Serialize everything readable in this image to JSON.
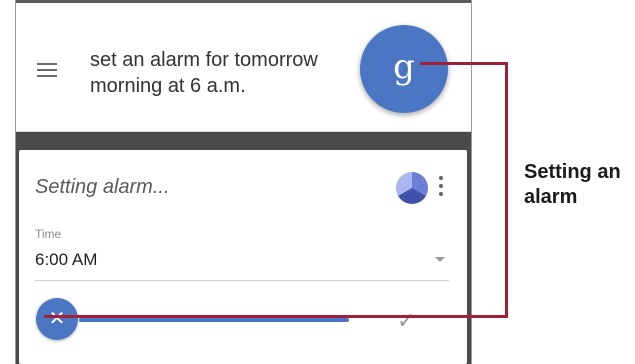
{
  "query": {
    "text": "set an alarm for tomorrow morning at 6 a.m.",
    "mic_glyph": "g"
  },
  "card": {
    "title": "Setting alarm...",
    "time_label": "Time",
    "time_value": "6:00 AM",
    "cancel_glyph": "✕",
    "confirm_glyph": "✓",
    "progress": 0.85
  },
  "callout": {
    "text": "Setting an alarm"
  },
  "colors": {
    "accent": "#4a76c4",
    "callout_line": "#a0203a",
    "backdrop": "#4a4a4a"
  },
  "icons": [
    "menu-icon",
    "google-g-icon",
    "assistant-icon",
    "more-vert-icon",
    "dropdown-caret-icon",
    "close-icon",
    "check-icon"
  ]
}
